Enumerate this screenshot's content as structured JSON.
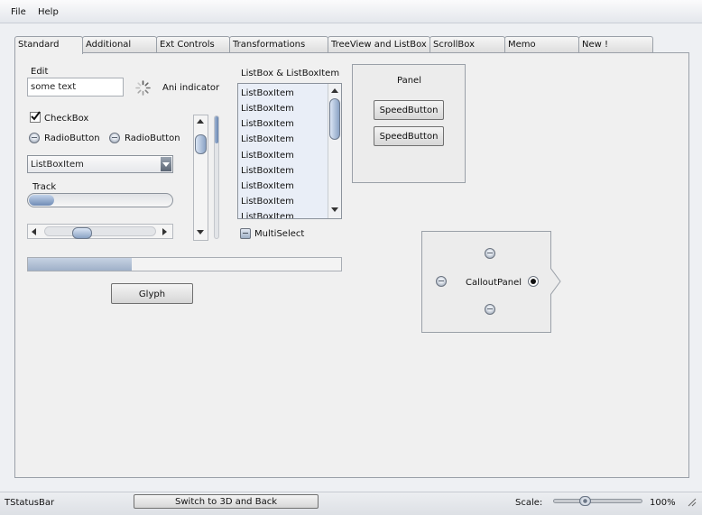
{
  "menu": {
    "file": "File",
    "help": "Help"
  },
  "tabs": [
    "Standard",
    "Additional",
    "Ext Controls",
    "Transformations",
    "TreeView and ListBox",
    "ScrollBox",
    "Memo",
    "New !"
  ],
  "active_tab": "Standard",
  "edit": {
    "label": "Edit",
    "value": "some text"
  },
  "ani_indicator": {
    "label": "Ani indicator",
    "icon": "spinner-icon"
  },
  "checkbox": {
    "label": "CheckBox",
    "checked": true
  },
  "radio_buttons": [
    {
      "label": "RadioButton",
      "checked": false
    },
    {
      "label": "RadioButton",
      "checked": false
    }
  ],
  "combobox": {
    "value": "ListBoxItem"
  },
  "track": {
    "label": "Track",
    "value": 0.18
  },
  "hscroll": {
    "value": 0.3
  },
  "vscroll": {
    "value": 0.1
  },
  "vbar": {
    "value": 0.22
  },
  "listbox": {
    "label": "ListBox & ListBoxItem",
    "items": [
      "ListBoxItem",
      "ListBoxItem",
      "ListBoxItem",
      "ListBoxItem",
      "ListBoxItem",
      "ListBoxItem",
      "ListBoxItem",
      "ListBoxItem",
      "ListBoxItem"
    ],
    "scroll_value": 0.1
  },
  "multiselect": {
    "label": "MultiSelect"
  },
  "progress": {
    "value": 0.33
  },
  "glyph_button": {
    "label": "Glyph"
  },
  "panel": {
    "label": "Panel",
    "buttons": [
      "SpeedButton",
      "SpeedButton"
    ]
  },
  "callout_panel": {
    "label": "CalloutPanel"
  },
  "statusbar": {
    "label": "TStatusBar",
    "switch_button": "Switch to 3D and Back",
    "scale_label": "Scale:",
    "scale_value": "100%",
    "scale_fraction": 0.34
  },
  "colors": {
    "accent": "#7f98bd",
    "list_bg": "#e9eef7",
    "content_bg": "#f0f0f0"
  }
}
